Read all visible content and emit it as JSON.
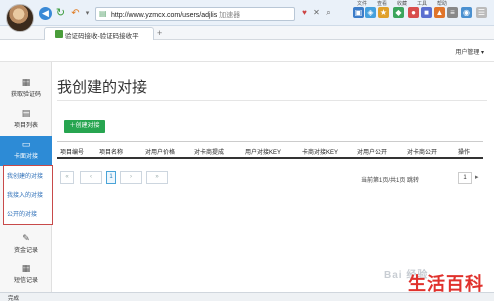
{
  "browser": {
    "url_main": "http://www.yzmcx.com/users/adjlis",
    "url_extra": "加速器",
    "tab_title": "验证码接收-验证码接收平",
    "new_tab": "+",
    "top_labels": [
      "文件",
      "查看",
      "收藏",
      "工具",
      "帮助"
    ]
  },
  "header": {
    "user_menu": "用户管理 ▾"
  },
  "sidebar": {
    "items": [
      {
        "label": "获取验证码",
        "icon": "grid-icon"
      },
      {
        "label": "项目列表",
        "icon": "list-icon"
      },
      {
        "label": "卡面对接",
        "icon": "card-icon"
      },
      {
        "label": "资金记录",
        "icon": "pen-icon"
      },
      {
        "label": "短信记录",
        "icon": "grid-icon"
      }
    ],
    "submenu": [
      "我创建的对接",
      "我接入的对接",
      "公开的对接"
    ]
  },
  "main": {
    "title": "我创建的对接",
    "create_button": "创建对接",
    "table_headers": [
      "项目编号",
      "项目名称",
      "对用户价格",
      "对卡商提成",
      "用户对接KEY",
      "卡商对接KEY",
      "对用户公开",
      "对卡商公开",
      "操作"
    ],
    "pager": [
      "«",
      "‹",
      "1",
      "›",
      "»"
    ],
    "current_page": "1",
    "page_info": "当前第1页/共1页 跳转",
    "jump_value": "1"
  },
  "status": {
    "text": "完成"
  },
  "watermark": {
    "brand_text": "生活百科",
    "baidu": "Bai 经验"
  },
  "colors": {
    "accent": "#2d8bd6",
    "create_button": "#27a550",
    "watermark_red": "#e0312c"
  }
}
